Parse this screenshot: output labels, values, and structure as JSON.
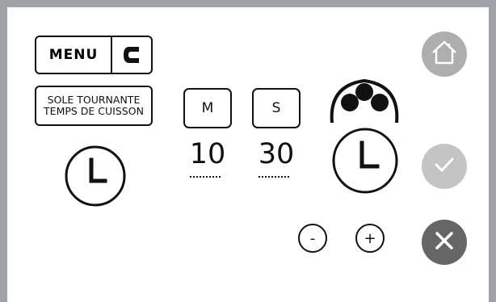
{
  "menu": {
    "label": "MENU",
    "back_icon": "c-logo-icon"
  },
  "program": {
    "line1": "SOLE TOURNANTE",
    "line2": "TEMPS DE CUISSON"
  },
  "timer": {
    "minutes_label": "M",
    "seconds_label": "S",
    "minutes_value": "10",
    "seconds_value": "30"
  },
  "controls": {
    "minus_label": "-",
    "plus_label": "+"
  },
  "icons": {
    "timer": "clock-icon",
    "fan": "fan-dots-icon",
    "home": "home-icon",
    "confirm": "check-icon",
    "cancel": "close-icon"
  },
  "colors": {
    "frame": "#9ea2a6",
    "home_button": "#aeaeae",
    "confirm_button": "#c4c4c4",
    "cancel_button": "#666666"
  }
}
